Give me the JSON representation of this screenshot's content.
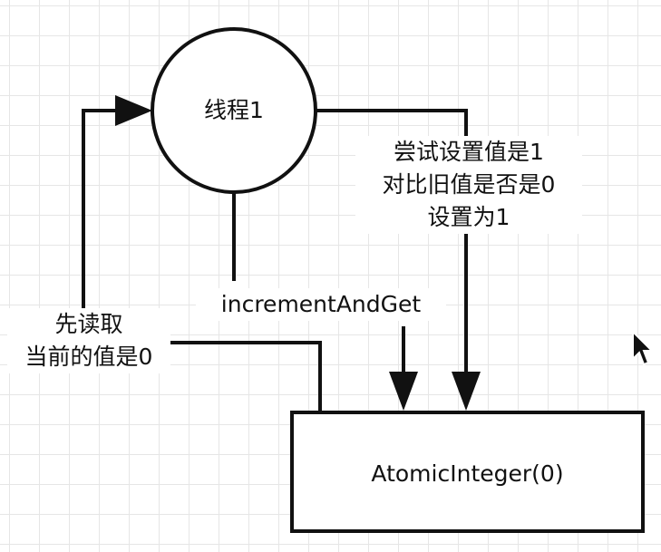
{
  "diagram": {
    "thread_node": {
      "label": "线程1"
    },
    "atomic_node": {
      "label": "AtomicInteger(0)"
    },
    "edge_read": {
      "lines": [
        "先读取",
        "当前的值是0"
      ]
    },
    "edge_increment": {
      "label": "incrementAndGet"
    },
    "edge_cas": {
      "lines": [
        "尝试设置值是1",
        "对比旧值是否是0",
        "设置为1"
      ]
    }
  }
}
